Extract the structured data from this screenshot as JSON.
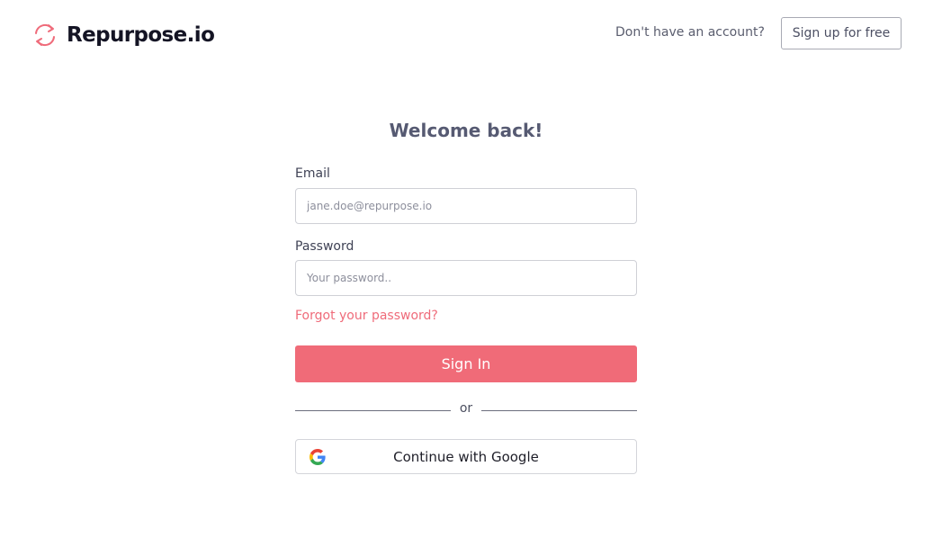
{
  "header": {
    "logo_text": "Repurpose.io",
    "account_prompt": "Don't have an account?",
    "signup_label": "Sign up for free"
  },
  "form": {
    "title": "Welcome back!",
    "email_label": "Email",
    "email_placeholder": "jane.doe@repurpose.io",
    "email_value": "",
    "password_label": "Password",
    "password_placeholder": "Your password..",
    "password_value": "",
    "forgot_label": "Forgot your password?",
    "signin_label": "Sign In",
    "divider_text": "or",
    "google_label": "Continue with Google"
  },
  "colors": {
    "accent": "#f06b78",
    "link": "#ef6b7a",
    "logo_text": "#141424",
    "border": "#cfd0d6"
  },
  "icons": {
    "logo": "refresh-arrows-icon",
    "google": "google-g-icon"
  }
}
